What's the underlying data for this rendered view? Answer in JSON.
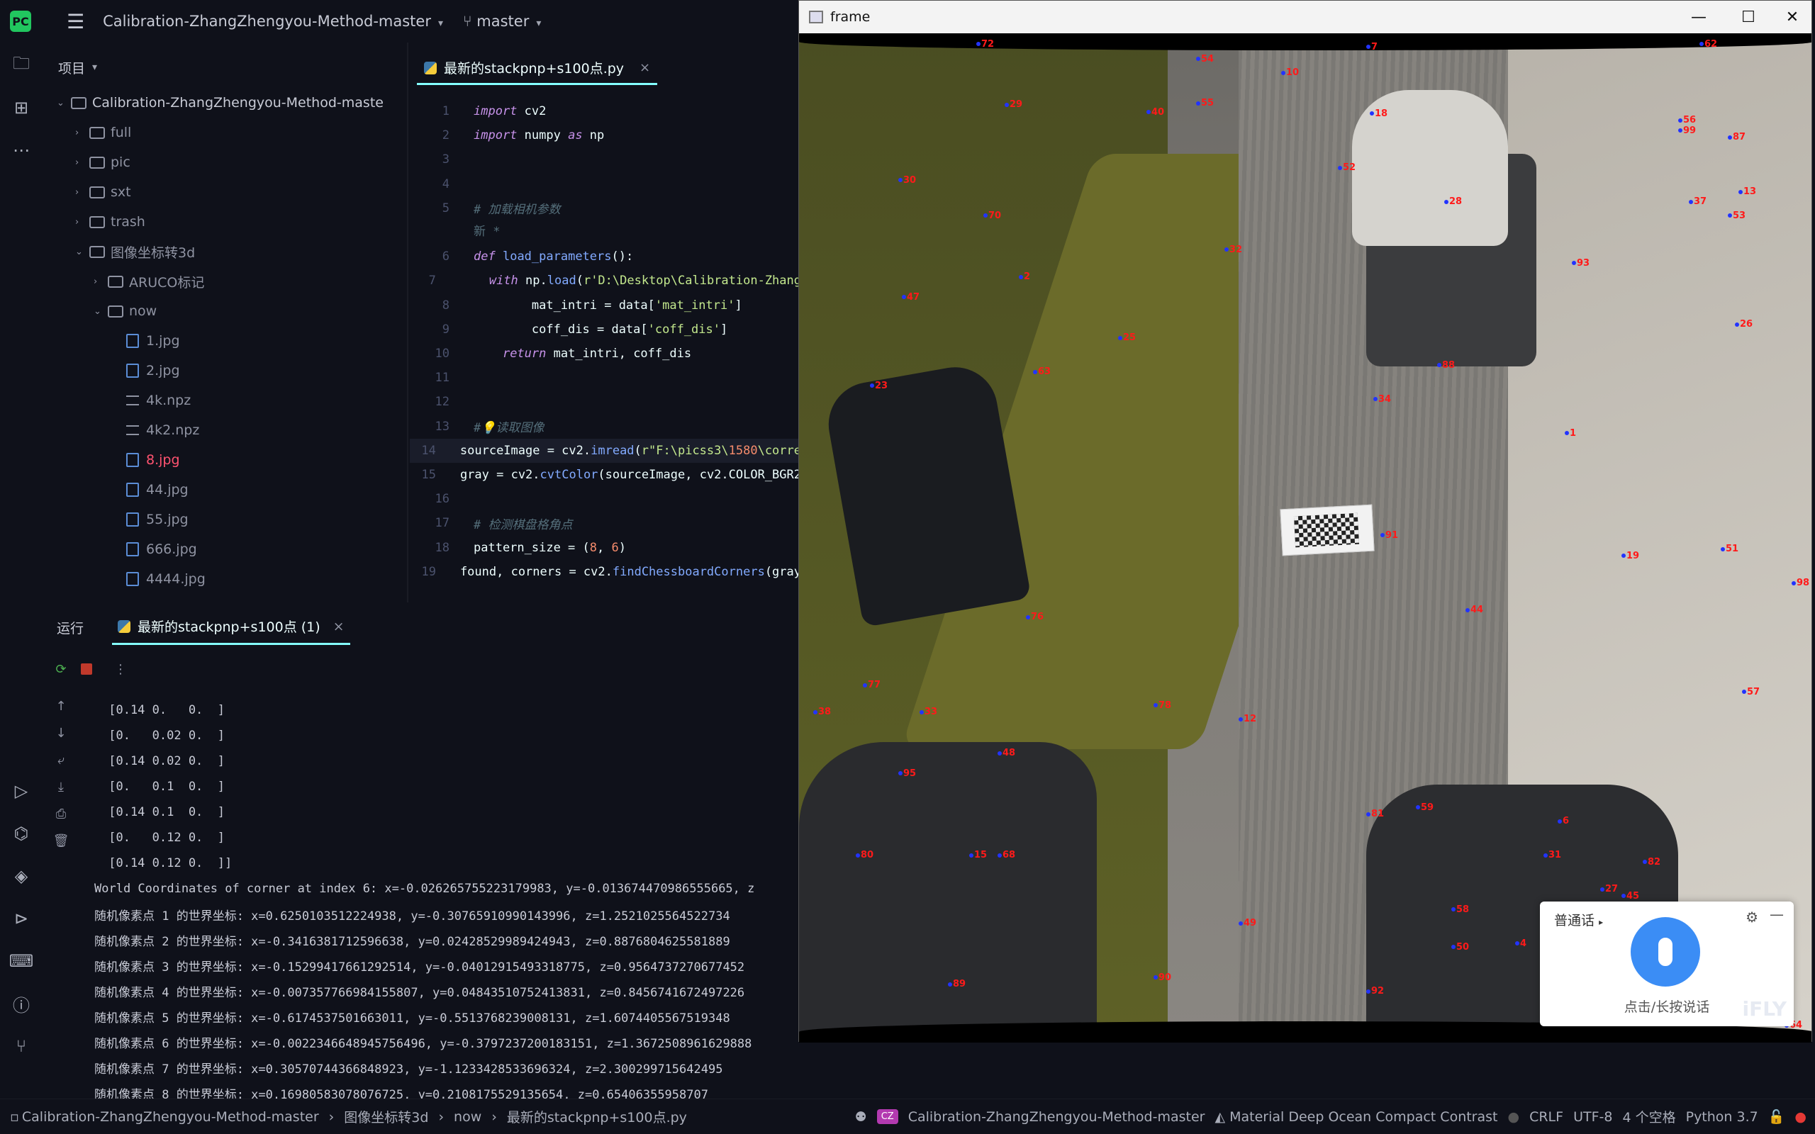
{
  "titlebar": {
    "project": "Calibration-ZhangZhengyou-Method-master",
    "branch": "master"
  },
  "project_panel": {
    "header": "项目",
    "tree": [
      {
        "label": "Calibration-ZhangZhengyou-Method-maste",
        "type": "folder",
        "depth": 0,
        "open": true
      },
      {
        "label": "full",
        "type": "folder",
        "depth": 1,
        "open": false
      },
      {
        "label": "pic",
        "type": "folder",
        "depth": 1,
        "open": false
      },
      {
        "label": "sxt",
        "type": "folder",
        "depth": 1,
        "open": false
      },
      {
        "label": "trash",
        "type": "folder",
        "depth": 1,
        "open": false
      },
      {
        "label": "图像坐标转3d",
        "type": "folder",
        "depth": 1,
        "open": true
      },
      {
        "label": "ARUCO标记",
        "type": "folder",
        "depth": 2,
        "open": false
      },
      {
        "label": "now",
        "type": "folder",
        "depth": 2,
        "open": true
      },
      {
        "label": "1.jpg",
        "type": "image",
        "depth": 3
      },
      {
        "label": "2.jpg",
        "type": "image",
        "depth": 3
      },
      {
        "label": "4k.npz",
        "type": "text",
        "depth": 3
      },
      {
        "label": "4k2.npz",
        "type": "text",
        "depth": 3
      },
      {
        "label": "8.jpg",
        "type": "image",
        "depth": 3,
        "highlight": true
      },
      {
        "label": "44.jpg",
        "type": "image",
        "depth": 3
      },
      {
        "label": "55.jpg",
        "type": "image",
        "depth": 3
      },
      {
        "label": "666.jpg",
        "type": "image",
        "depth": 3
      },
      {
        "label": "4444.jpg",
        "type": "image",
        "depth": 3
      }
    ]
  },
  "editor": {
    "tab": "最新的stackpnp+s100点.py",
    "lines": [
      {
        "n": "1",
        "code": "import cv2"
      },
      {
        "n": "2",
        "code": "import numpy as np"
      },
      {
        "n": "3",
        "code": ""
      },
      {
        "n": "4",
        "code": ""
      },
      {
        "n": "5",
        "code": "# 加载相机参数"
      },
      {
        "n": "",
        "code": "新 *"
      },
      {
        "n": "6",
        "code": "def load_parameters():"
      },
      {
        "n": "7",
        "code": "    with np.load(r'D:\\Desktop\\Calibration-Zhang"
      },
      {
        "n": "8",
        "code": "        mat_intri = data['mat_intri']"
      },
      {
        "n": "9",
        "code": "        coff_dis = data['coff_dis']"
      },
      {
        "n": "10",
        "code": "    return mat_intri, coff_dis"
      },
      {
        "n": "11",
        "code": ""
      },
      {
        "n": "12",
        "code": ""
      },
      {
        "n": "13",
        "code": "#💡读取图像"
      },
      {
        "n": "14",
        "code": "sourceImage = cv2.imread(r\"F:\\picss3\\1580\\corre"
      },
      {
        "n": "15",
        "code": "gray = cv2.cvtColor(sourceImage, cv2.COLOR_BGR2"
      },
      {
        "n": "16",
        "code": ""
      },
      {
        "n": "17",
        "code": "# 检测棋盘格角点"
      },
      {
        "n": "18",
        "code": "pattern_size = (8, 6)"
      },
      {
        "n": "19",
        "code": "found, corners = cv2.findChessboardCorners(gray"
      }
    ]
  },
  "run": {
    "header": "运行",
    "tab": "最新的stackpnp+s100点 (1)",
    "output": [
      " [0.14 0.   0.  ]",
      " [0.   0.02 0.  ]",
      " [0.14 0.02 0.  ]",
      " [0.   0.1  0.  ]",
      " [0.14 0.1  0.  ]",
      " [0.   0.12 0.  ]",
      " [0.14 0.12 0.  ]]",
      "World Coordinates of corner at index 6: x=-0.026265755223179983, y=-0.013674470986555665, z",
      "随机像素点 1 的世界坐标: x=0.6250103512224938, y=-0.30765910990143996, z=1.2521025564522734",
      "随机像素点 2 的世界坐标: x=-0.3416381712596638, y=0.02428529989424943, z=0.8876804625581889",
      "随机像素点 3 的世界坐标: x=-0.15299417661292514, y=-0.04012915493318775, z=0.9564737270677452",
      "随机像素点 4 的世界坐标: x=-0.007357766984155807, y=0.04843510752413831, z=0.8456741672497226",
      "随机像素点 5 的世界坐标: x=-0.6174537501663011, y=-0.5513768239008131, z=1.6074405567519348",
      "随机像素点 6 的世界坐标: x=-0.0022346648945756496, y=-0.3797237200183151, z=1.3672508961629888",
      "随机像素点 7 的世界坐标: x=0.30570744366848923, y=-1.1233428533696324, z=2.300299715642495",
      "随机像素点 8 的世界坐标: x=0.16980583078076725, y=0.2108175529135654, z=0.65406355958707"
    ]
  },
  "frame_window": {
    "title": "frame",
    "labels": [
      "72",
      "54",
      "7",
      "62",
      "55",
      "10",
      "18",
      "56",
      "29",
      "99",
      "87",
      "40",
      "13",
      "53",
      "37",
      "52",
      "28",
      "32",
      "30",
      "70",
      "2",
      "47",
      "25",
      "63",
      "88",
      "34",
      "23",
      "1",
      "91",
      "19",
      "44",
      "76",
      "77",
      "38",
      "95",
      "48",
      "12",
      "81",
      "6",
      "35",
      "92",
      "90",
      "89",
      "64",
      "14",
      "22",
      "4",
      "50",
      "82",
      "45",
      "58",
      "57",
      "78",
      "15",
      "59",
      "27",
      "51",
      "26",
      "93",
      "98",
      "68",
      "49",
      "80",
      "33",
      "31"
    ]
  },
  "ime": {
    "mode": "普通话",
    "hint": "点击/长按说话",
    "brand": "iFLY"
  },
  "statusbar": {
    "crumbs": [
      "Calibration-ZhangZhengyou-Method-master",
      "图像坐标转3d",
      "now",
      "最新的stackpnp+s100点.py"
    ],
    "project": "Calibration-ZhangZhengyou-Method-master",
    "avatar": "CZ",
    "theme": "Material Deep Ocean Compact Contrast",
    "line_sep": "CRLF",
    "encoding": "UTF-8",
    "indent": "4 个空格",
    "python": "Python 3.7"
  }
}
